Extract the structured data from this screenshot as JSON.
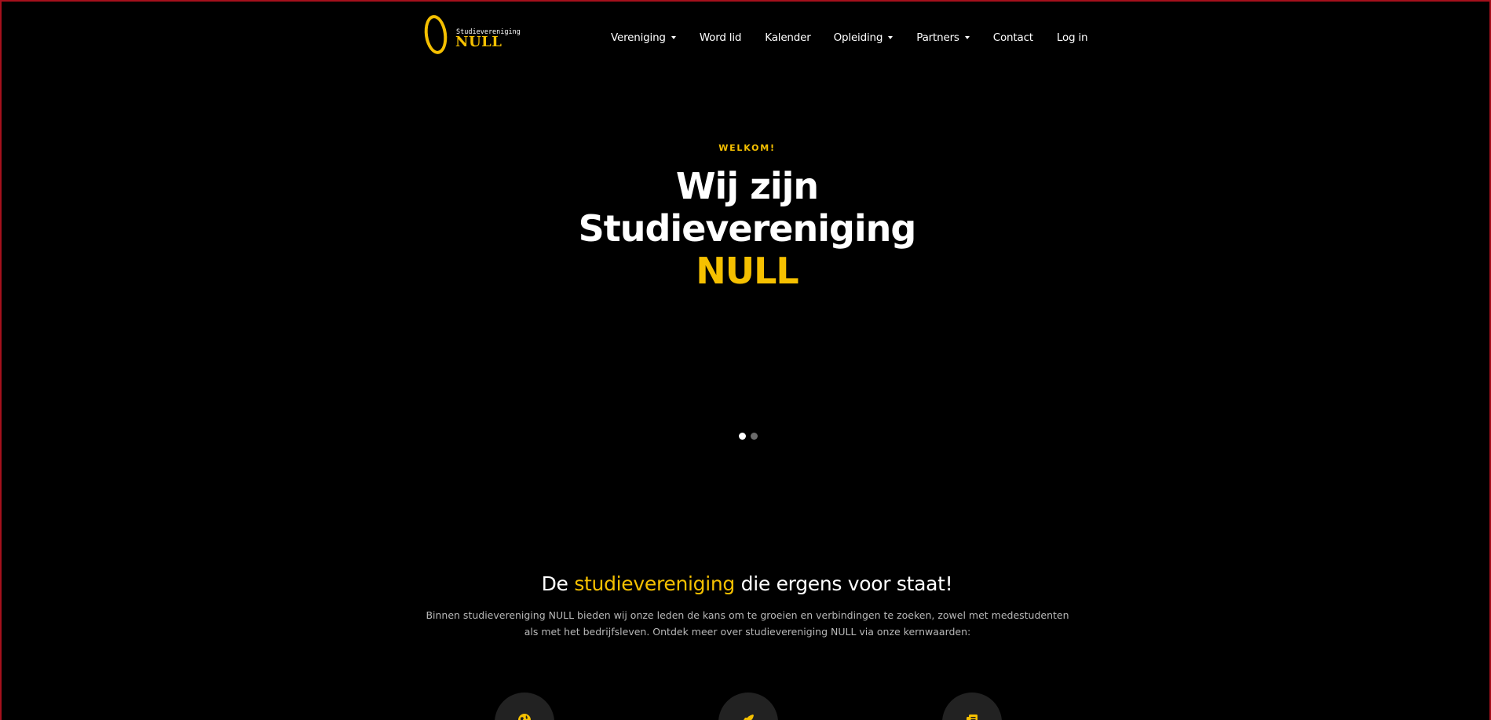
{
  "brand": {
    "small_text": "Studievereniging",
    "big_text": "NULL",
    "accent_color": "#f5c000",
    "frame_color": "#a5101c"
  },
  "nav": {
    "items": [
      {
        "label": "Vereniging",
        "dropdown": true
      },
      {
        "label": "Word lid",
        "dropdown": false
      },
      {
        "label": "Kalender",
        "dropdown": false
      },
      {
        "label": "Opleiding",
        "dropdown": true
      },
      {
        "label": "Partners",
        "dropdown": true
      },
      {
        "label": "Contact",
        "dropdown": false
      },
      {
        "label": "Log in",
        "dropdown": false
      }
    ]
  },
  "hero": {
    "kicker": "WELKOM!",
    "title_line1": "Wij zijn",
    "title_line2": "Studievereniging",
    "title_line3": "NULL",
    "slides_total": 2,
    "active_slide": 1
  },
  "intro": {
    "heading_pre": "De",
    "heading_highlight": "studievereniging",
    "heading_post": "die ergens voor staat!",
    "text": "Binnen studievereniging NULL bieden wij onze leden de kans om te groeien en verbindingen te zoeken, zowel met medestudenten als met het bedrijfsleven. Ontdek meer over studievereniging NULL via onze kernwaarden:"
  },
  "values": {
    "icons": [
      "globe-icon",
      "rocket-icon",
      "document-icon"
    ]
  }
}
